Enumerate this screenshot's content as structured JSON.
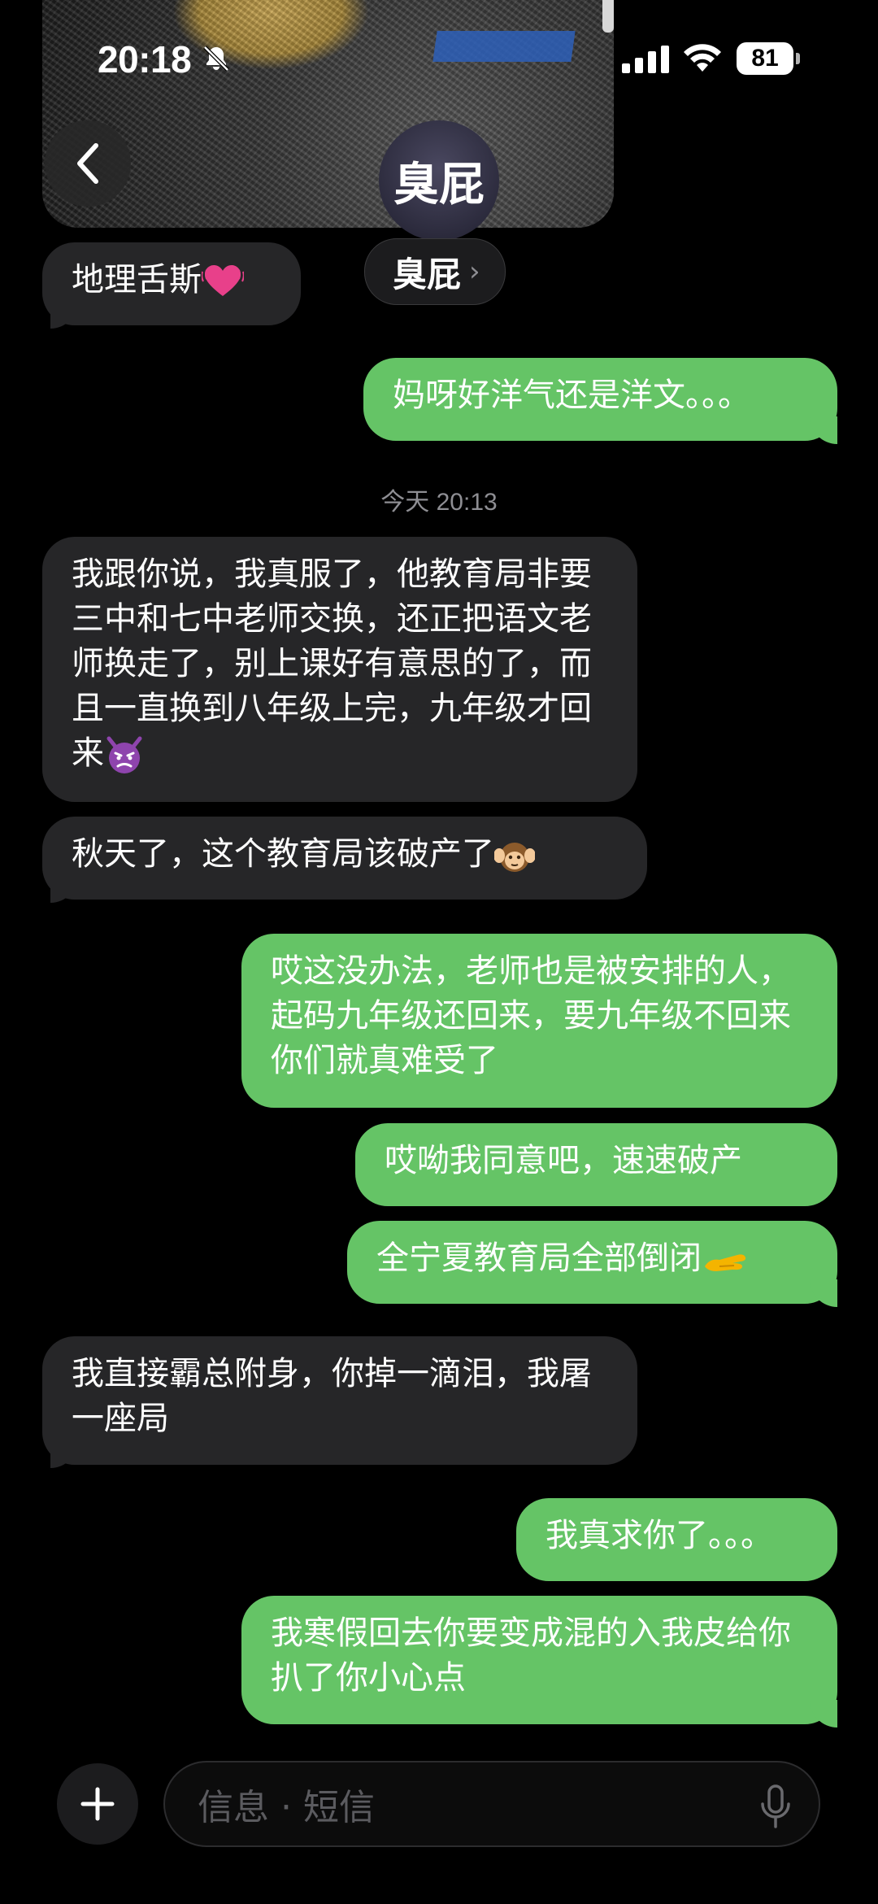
{
  "status_bar": {
    "time": "20:18",
    "battery": "81"
  },
  "header": {
    "avatar_text": "臭屁",
    "contact_name": "臭屁",
    "chevron": "›"
  },
  "messages": [
    {
      "dir": "in",
      "text": "地理舌斯"
    },
    {
      "dir": "out",
      "text": "妈呀好洋气还是洋文。。。"
    },
    {
      "dir": "in",
      "text": "我跟你说，我真服了，他教育局非要三中和七中老师交换，还正把语文老师换走了，别上课好有意思的了，而且一直换到八年级上完，九年级才回来"
    },
    {
      "dir": "in",
      "text": "秋天了，这个教育局该破产了"
    },
    {
      "dir": "out",
      "text": "哎这没办法，老师也是被安排的人，起码九年级还回来，要九年级不回来你们就真难受了"
    },
    {
      "dir": "out",
      "text": "哎呦我同意吧，速速破产"
    },
    {
      "dir": "out",
      "text": "全宁夏教育局全部倒闭"
    },
    {
      "dir": "in",
      "text": "我直接霸总附身，你掉一滴泪，我屠一座局"
    },
    {
      "dir": "out",
      "text": "我真求你了。。。"
    },
    {
      "dir": "out",
      "text": "我寒假回去你要变成混的入我皮给你扒了你小心点"
    }
  ],
  "timestamp": "今天 20:13",
  "composer": {
    "placeholder": "信息 · 短信"
  },
  "colors": {
    "incoming_bubble": "#262628",
    "outgoing_bubble": "#65c466",
    "background": "#000000"
  },
  "icons": {
    "back": "chevron-left-icon",
    "mute": "bell-slash-icon",
    "signal": "cellular-signal-icon",
    "wifi": "wifi-icon",
    "add": "plus-icon",
    "mic": "microphone-icon"
  }
}
